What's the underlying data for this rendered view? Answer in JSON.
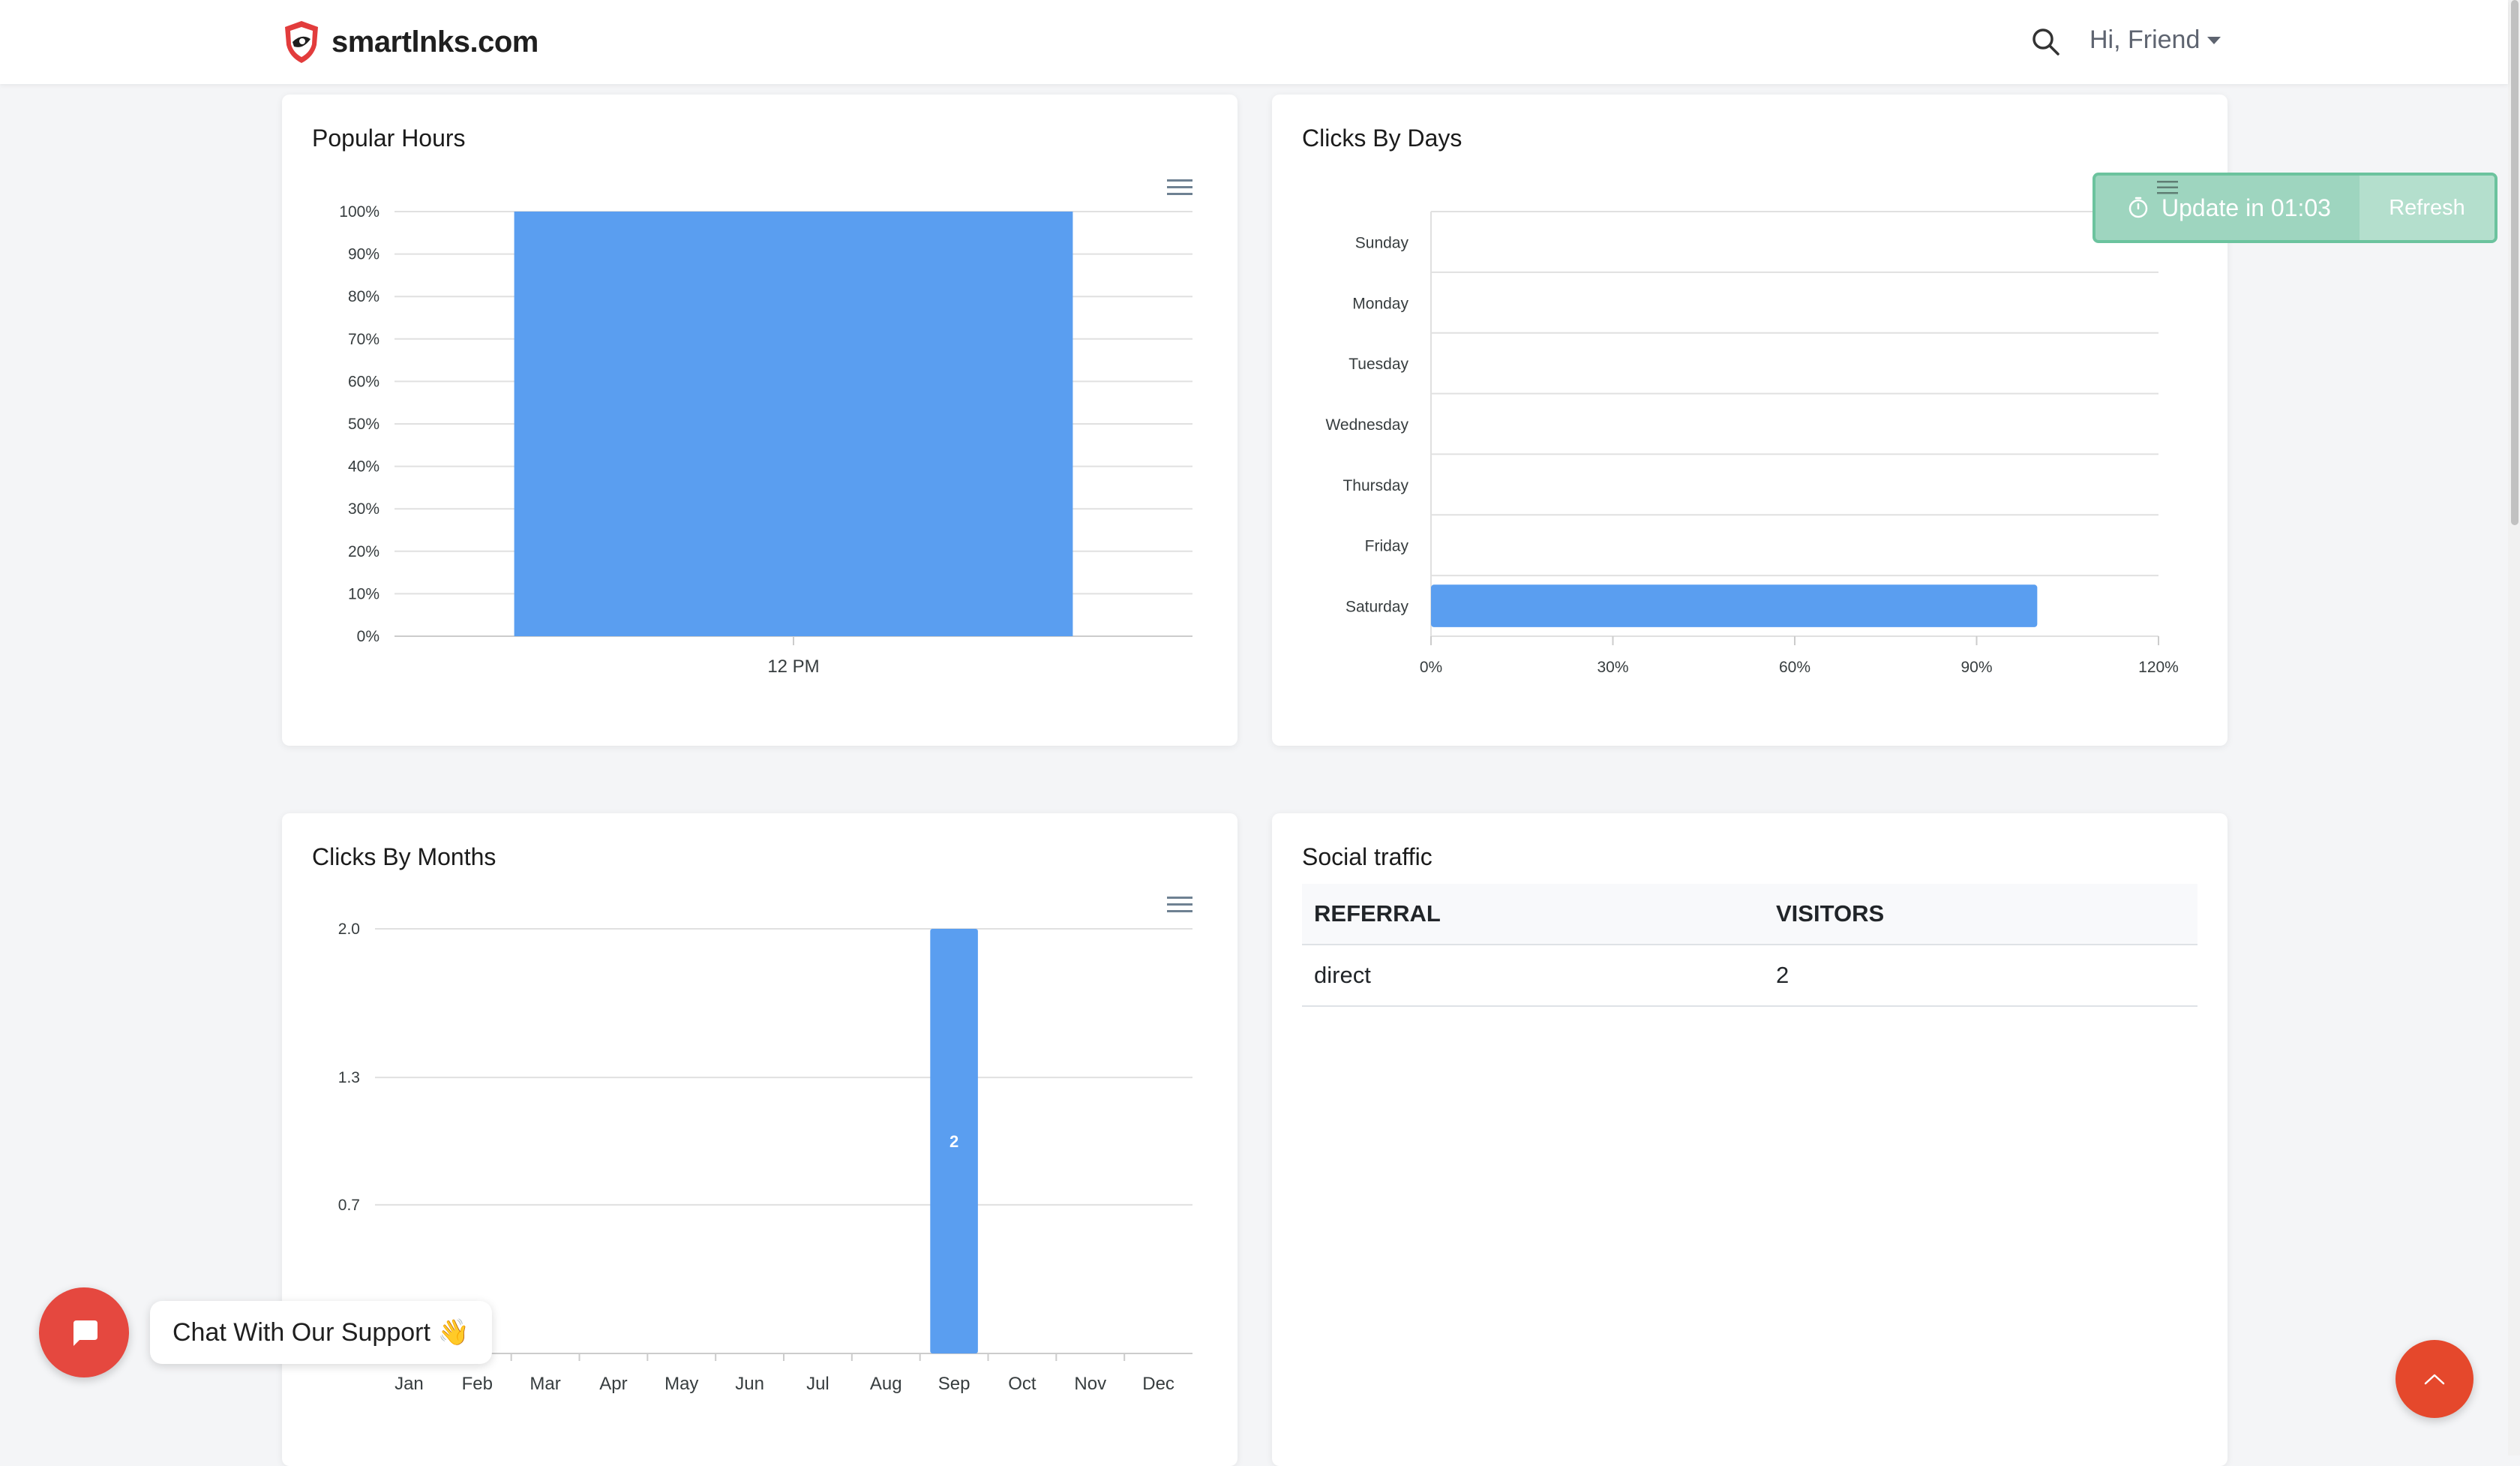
{
  "brand": {
    "name": "smartlnks.com"
  },
  "nav": {
    "greeting": "Hi, Friend"
  },
  "colors": {
    "accent": "#5a9ef0",
    "toast": "#9ed5bf",
    "chat": "#e5483f",
    "top_button": "#e5482c"
  },
  "toast": {
    "text": "Update in 01:03",
    "refresh_label": "Refresh"
  },
  "chat": {
    "label": "Chat With Our Support",
    "emoji": "👋"
  },
  "popular_hours": {
    "title": "Popular Hours"
  },
  "clicks_by_days": {
    "title": "Clicks By Days"
  },
  "clicks_by_months": {
    "title": "Clicks By Months"
  },
  "social": {
    "title": "Social traffic",
    "headers": [
      "REFERRAL",
      "VISITORS"
    ],
    "rows": [
      {
        "referral": "direct",
        "visitors": "2"
      }
    ]
  },
  "chart_data": [
    {
      "type": "bar",
      "title": "Popular Hours",
      "categories": [
        "12 PM"
      ],
      "values": [
        100
      ],
      "ylim": [
        0,
        100
      ],
      "yticks": [
        "0%",
        "10%",
        "20%",
        "30%",
        "40%",
        "50%",
        "60%",
        "70%",
        "80%",
        "90%",
        "100%"
      ],
      "grid": true
    },
    {
      "type": "bar",
      "orientation": "horizontal",
      "title": "Clicks By Days",
      "categories": [
        "Sunday",
        "Monday",
        "Tuesday",
        "Wednesday",
        "Thursday",
        "Friday",
        "Saturday"
      ],
      "values": [
        0,
        0,
        0,
        0,
        0,
        0,
        100
      ],
      "xlim": [
        0,
        120
      ],
      "xticks": [
        "0%",
        "30%",
        "60%",
        "90%",
        "120%"
      ],
      "grid": true
    },
    {
      "type": "bar",
      "title": "Clicks By Months",
      "categories": [
        "Jan",
        "Feb",
        "Mar",
        "Apr",
        "May",
        "Jun",
        "Jul",
        "Aug",
        "Sep",
        "Oct",
        "Nov",
        "Dec"
      ],
      "values": [
        0,
        0,
        0,
        0,
        0,
        0,
        0,
        0,
        2,
        0,
        0,
        0
      ],
      "data_labels": [
        "",
        "",
        "",
        "",
        "",
        "",
        "",
        "",
        "2",
        "",
        "",
        ""
      ],
      "ylim": [
        0,
        2
      ],
      "yticks": [
        "0.7",
        "1.3",
        "2.0"
      ],
      "grid": true
    }
  ]
}
